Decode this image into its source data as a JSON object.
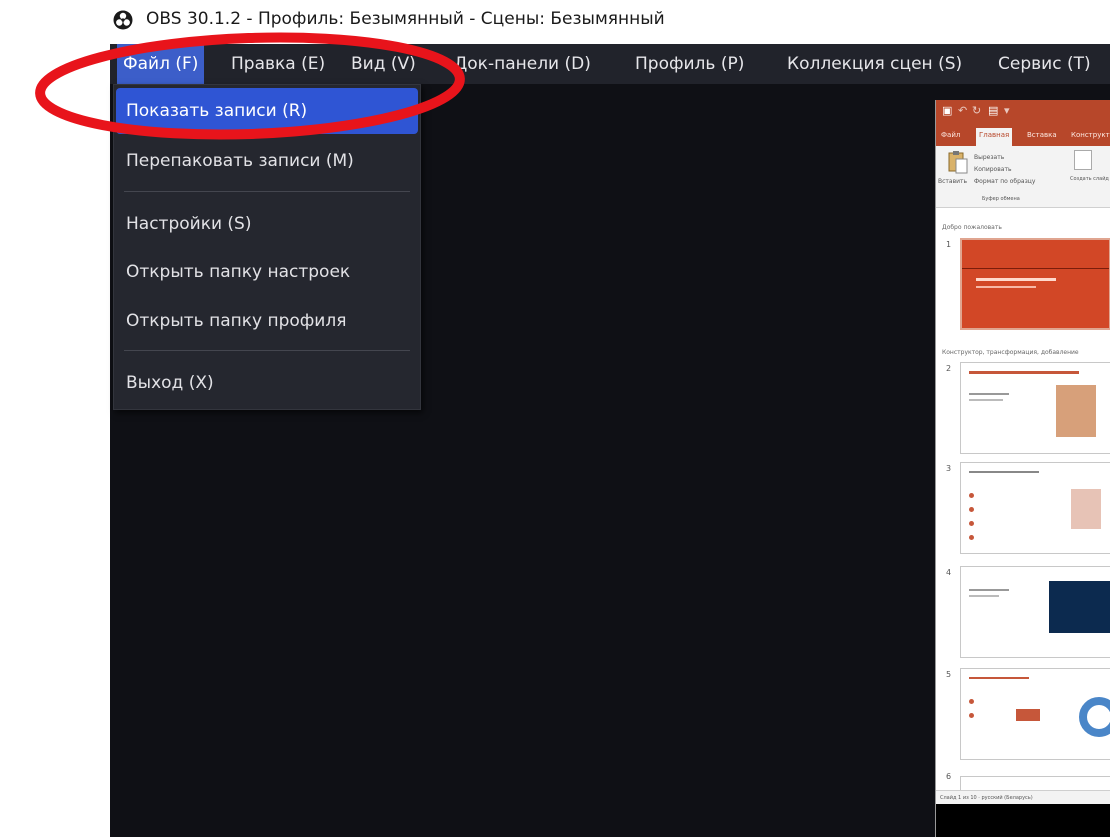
{
  "window": {
    "title": "OBS 30.1.2 - Профиль: Безымянный - Сцены: Безымянный"
  },
  "menubar": {
    "items": [
      {
        "label": "Файл (F)",
        "active": true
      },
      {
        "label": "Правка (E)"
      },
      {
        "label": "Вид (V)"
      },
      {
        "label": "Док-панели (D)"
      },
      {
        "label": "Профиль (P)"
      },
      {
        "label": "Коллекция сцен (S)"
      },
      {
        "label": "Сервис (T)"
      }
    ]
  },
  "file_menu": {
    "items": [
      {
        "label": "Показать записи (R)",
        "highlighted": true
      },
      {
        "label": "Перепаковать записи (M)"
      },
      {
        "label": "Настройки (S)"
      },
      {
        "label": "Открыть папку настроек"
      },
      {
        "label": "Открыть папку профиля"
      },
      {
        "label": "Выход (X)"
      }
    ]
  },
  "powerpoint_preview": {
    "tabs": [
      "Файл",
      "Главная",
      "Вставка",
      "Конструктор"
    ],
    "ribbon": {
      "paste": "Вставить",
      "cut": "Вырезать",
      "copy": "Копировать",
      "format_painter": "Формат по образцу",
      "clipboard_group": "Буфер обмена",
      "new_slide": "Создать слайд"
    },
    "section_1": "Добро пожаловать",
    "section_2": "Конструктор, трансформация, добавление",
    "slide_numbers": [
      "1",
      "2",
      "3",
      "4",
      "5",
      "6"
    ],
    "status": "Слайд 1 из 10 · русский (Беларусь)"
  },
  "colors": {
    "menubar_bg": "#21232b",
    "menu_active": "#3c5ec9",
    "dropdown_bg": "#25272f",
    "dropdown_highlight": "#2f55d4",
    "workspace_bg": "#0f1015",
    "annotation": "#e8141b",
    "ppt_accent": "#b7472a"
  }
}
